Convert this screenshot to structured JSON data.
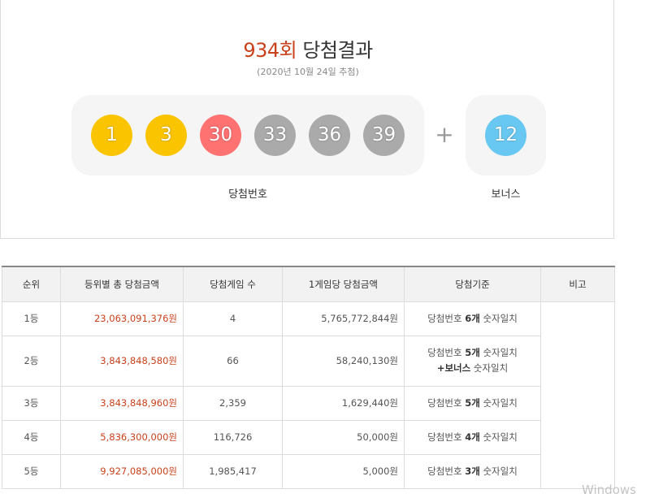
{
  "header": {
    "round": "934회",
    "title": "당첨결과",
    "draw_date": "(2020년 10월 24일 추첨)"
  },
  "winning_numbers": [
    {
      "value": "1",
      "color": "#fbc400"
    },
    {
      "value": "3",
      "color": "#fbc400"
    },
    {
      "value": "30",
      "color": "#ff7272"
    },
    {
      "value": "33",
      "color": "#aaaaaa"
    },
    {
      "value": "36",
      "color": "#aaaaaa"
    },
    {
      "value": "39",
      "color": "#aaaaaa"
    }
  ],
  "plus_sign": "+",
  "bonus": {
    "value": "12",
    "color": "#69c8f2"
  },
  "labels": {
    "winning": "당첨번호",
    "bonus": "보너스"
  },
  "table": {
    "headers": [
      "순위",
      "등위별 총 당첨금액",
      "당첨게임 수",
      "1게임당 당첨금액",
      "당첨기준",
      "비고"
    ],
    "rows": [
      {
        "rank": "1등",
        "total": "23,063,091,376원",
        "games": "4",
        "per_game": "5,765,772,844원",
        "crit_pre": "당첨번호 ",
        "crit_bold": "6개",
        "crit_post": " 숫자일치",
        "crit2_bold": "",
        "crit2_post": ""
      },
      {
        "rank": "2등",
        "total": "3,843,848,580원",
        "games": "66",
        "per_game": "58,240,130원",
        "crit_pre": "당첨번호 ",
        "crit_bold": "5개",
        "crit_post": " 숫자일치",
        "crit2_bold": "+보너스",
        "crit2_post": " 숫자일치"
      },
      {
        "rank": "3등",
        "total": "3,843,848,960원",
        "games": "2,359",
        "per_game": "1,629,440원",
        "crit_pre": "당첨번호 ",
        "crit_bold": "5개",
        "crit_post": " 숫자일치",
        "crit2_bold": "",
        "crit2_post": ""
      },
      {
        "rank": "4등",
        "total": "5,836,300,000원",
        "games": "116,726",
        "per_game": "50,000원",
        "crit_pre": "당첨번호 ",
        "crit_bold": "4개",
        "crit_post": " 숫자일치",
        "crit2_bold": "",
        "crit2_post": ""
      },
      {
        "rank": "5등",
        "total": "9,927,085,000원",
        "games": "1,985,417",
        "per_game": "5,000원",
        "crit_pre": "당첨번호 ",
        "crit_bold": "3개",
        "crit_post": " 숫자일치",
        "crit2_bold": "",
        "crit2_post": ""
      }
    ]
  },
  "watermark": "Windows 정"
}
